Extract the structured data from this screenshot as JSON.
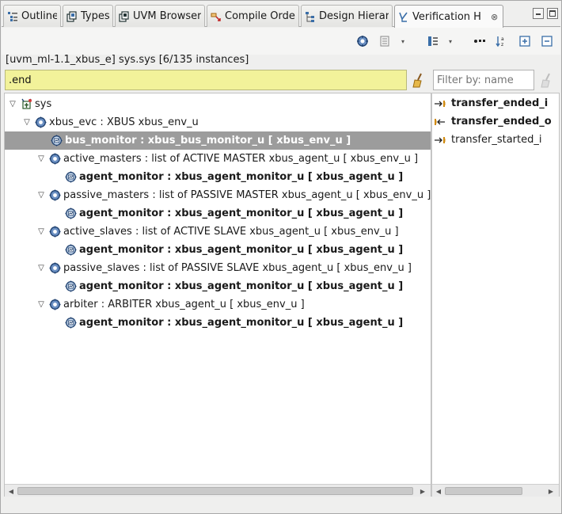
{
  "tabs": [
    {
      "label": "Outline",
      "icon": "outline-icon"
    },
    {
      "label": "Types",
      "icon": "types-icon"
    },
    {
      "label": "UVM Browser",
      "icon": "uvm-browser-icon"
    },
    {
      "label": "Compile Orde",
      "icon": "compile-order-icon"
    },
    {
      "label": "Design Hierar",
      "icon": "design-hierarchy-icon"
    },
    {
      "label": "Verification H",
      "icon": "verification-hierarchy-icon",
      "close": "⊗",
      "active": true
    }
  ],
  "window_buttons": [
    "minimize-button",
    "maximize-button"
  ],
  "header_path": "[uvm_ml-1.1_xbus_e] sys.sys [6/135 instances]",
  "search": {
    "value": ".end"
  },
  "filter": {
    "placeholder": "Filter by: name"
  },
  "tree": [
    {
      "label": "sys",
      "twisty": "▽",
      "icon": "root-unit-icon",
      "bold": false
    },
    {
      "label": "xbus_evc : XBUS xbus_env_u",
      "twisty": "▽",
      "icon": "unit-icon",
      "bold": false
    },
    {
      "label": "bus_monitor : xbus_bus_monitor_u [ xbus_env_u ]",
      "twisty": "",
      "icon": "monitor-unit-icon",
      "bold": true,
      "selected": true
    },
    {
      "label": "active_masters : list of ACTIVE MASTER xbus_agent_u [ xbus_env_u ]",
      "twisty": "▽",
      "icon": "unit-icon",
      "bold": false
    },
    {
      "label": "agent_monitor : xbus_agent_monitor_u [ xbus_agent_u ]",
      "twisty": "",
      "icon": "monitor-unit-icon",
      "bold": true
    },
    {
      "label": "passive_masters : list of PASSIVE MASTER xbus_agent_u [ xbus_env_u ]",
      "twisty": "▽",
      "icon": "unit-icon",
      "bold": false
    },
    {
      "label": "agent_monitor : xbus_agent_monitor_u [ xbus_agent_u ]",
      "twisty": "",
      "icon": "monitor-unit-icon",
      "bold": true
    },
    {
      "label": "active_slaves : list of ACTIVE SLAVE xbus_agent_u [ xbus_env_u ]",
      "twisty": "▽",
      "icon": "unit-icon",
      "bold": false
    },
    {
      "label": "agent_monitor : xbus_agent_monitor_u [ xbus_agent_u ]",
      "twisty": "",
      "icon": "monitor-unit-icon",
      "bold": true
    },
    {
      "label": "passive_slaves : list of PASSIVE SLAVE xbus_agent_u [ xbus_env_u ]",
      "twisty": "▽",
      "icon": "unit-icon",
      "bold": false
    },
    {
      "label": "agent_monitor : xbus_agent_monitor_u [ xbus_agent_u ]",
      "twisty": "",
      "icon": "monitor-unit-icon",
      "bold": true
    },
    {
      "label": "arbiter : ARBITER xbus_agent_u [ xbus_env_u ]",
      "twisty": "▽",
      "icon": "unit-icon",
      "bold": false
    },
    {
      "label": "agent_monitor : xbus_agent_monitor_u [ xbus_agent_u ]",
      "twisty": "",
      "icon": "monitor-unit-icon",
      "bold": true
    }
  ],
  "events": [
    {
      "label": "transfer_ended_i",
      "bold": true,
      "icon": "event-port-in-icon"
    },
    {
      "label": "transfer_ended_o",
      "bold": true,
      "icon": "event-port-out-icon"
    },
    {
      "label": "transfer_started_i",
      "bold": false,
      "icon": "event-port-in-icon"
    }
  ],
  "colors": {
    "search_bg": "#f2f29a",
    "selection": "#9c9c9c",
    "icon_blue": "#3a6ea8"
  }
}
